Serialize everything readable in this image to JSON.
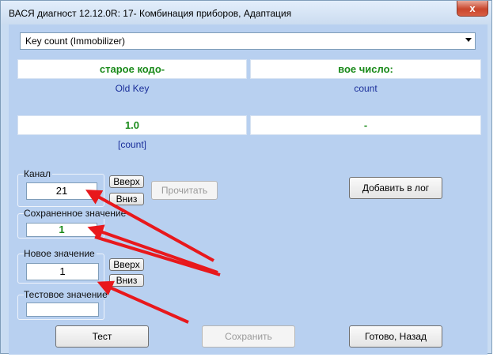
{
  "window": {
    "title": "ВАСЯ диагност 12.12.0R: 17- Комбинация приборов, Адаптация",
    "close_glyph": "x"
  },
  "channel_select": {
    "value": "Key count (Immobilizer)"
  },
  "header": {
    "left_title": "старое кодо-",
    "right_title": "вое число:",
    "left_sub": "Old Key",
    "right_sub": "count",
    "left_value": "1.0",
    "right_value": "-",
    "left_unit": "[count]"
  },
  "channel_group": {
    "label": "Канал",
    "value": "21",
    "up_label": "Вверх",
    "down_label": "Вниз"
  },
  "read_button": "Прочитать",
  "add_log_button": "Добавить в лог",
  "saved_group": {
    "label": "Сохраненное значение",
    "value": "1"
  },
  "new_group": {
    "label": "Новое значение",
    "value": "1",
    "up_label": "Вверх",
    "down_label": "Вниз"
  },
  "test_group": {
    "label": "Тестовое значение",
    "value": ""
  },
  "buttons": {
    "test": "Тест",
    "save": "Сохранить",
    "done": "Готово, Назад"
  },
  "colors": {
    "value_green": "#1a8a1a",
    "sub_blue": "#1a2e9a",
    "arrow_red": "#e8181c",
    "client_bg": "#b8d0f0"
  }
}
